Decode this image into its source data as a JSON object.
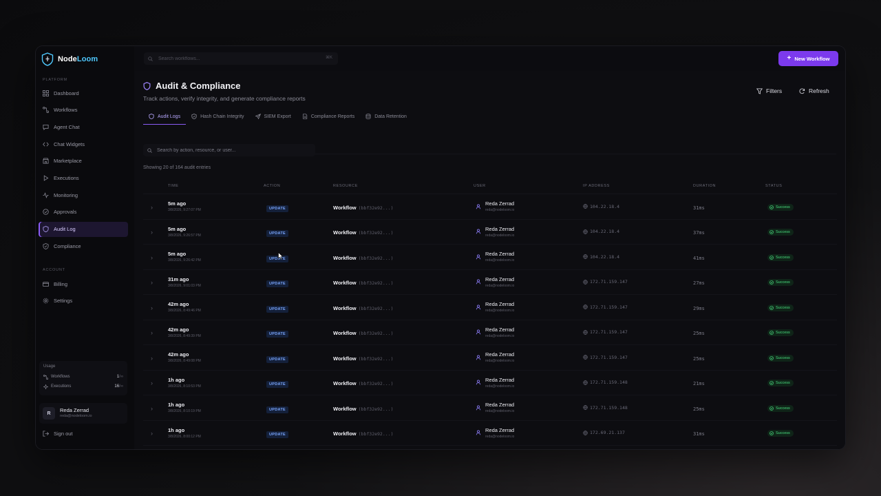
{
  "brand": {
    "name_a": "Node",
    "name_b": "Loom"
  },
  "search_top": {
    "placeholder": "Search workflows...",
    "shortcut": "⌘K"
  },
  "topbar": {
    "new_workflow": "New Workflow"
  },
  "sidebar": {
    "platform_label": "PLATFORM",
    "items": [
      {
        "label": "Dashboard",
        "icon": "grid-icon"
      },
      {
        "label": "Workflows",
        "icon": "workflow-icon"
      },
      {
        "label": "Agent Chat",
        "icon": "chat-icon"
      },
      {
        "label": "Chat Widgets",
        "icon": "code-icon"
      },
      {
        "label": "Marketplace",
        "icon": "store-icon"
      },
      {
        "label": "Executions",
        "icon": "play-icon"
      },
      {
        "label": "Monitoring",
        "icon": "activity-icon"
      },
      {
        "label": "Approvals",
        "icon": "check-circle-icon"
      },
      {
        "label": "Audit Log",
        "icon": "shield-icon"
      },
      {
        "label": "Compliance",
        "icon": "shield-check-icon"
      }
    ],
    "active_index": 8,
    "account_label": "ACCOUNT",
    "account_items": [
      {
        "label": "Billing",
        "icon": "credit-card-icon"
      },
      {
        "label": "Settings",
        "icon": "gear-icon"
      }
    ],
    "usage": {
      "title": "Usage",
      "workflows_label": "Workflows",
      "workflows_value": "1",
      "workflows_suffix": "/∞",
      "executions_label": "Executions",
      "executions_value": "16",
      "executions_suffix": "/∞"
    },
    "user": {
      "initial": "R",
      "name": "Reda Zerrad",
      "email": "reda@nodeloom.io"
    },
    "signout": "Sign out"
  },
  "page": {
    "title": "Audit & Compliance",
    "subtitle": "Track actions, verify integrity, and generate compliance reports",
    "filters": "Filters",
    "refresh": "Refresh",
    "tabs": [
      "Audit Logs",
      "Hash Chain Integrity",
      "SIEM Export",
      "Compliance Reports",
      "Data Retention"
    ],
    "search_placeholder": "Search by action, resource, or user...",
    "showing": "Showing 20 of 164 audit entries"
  },
  "table": {
    "columns": [
      "TIME",
      "ACTION",
      "RESOURCE",
      "USER",
      "IP ADDRESS",
      "DURATION",
      "STATUS"
    ],
    "rows": [
      {
        "time": "5m ago",
        "ts": "3/8/2026, 9:27:07 PM",
        "action": "UPDATE",
        "resource": "Workflow",
        "res_id": "(bbf32e92...)",
        "user": "Reda Zerrad",
        "email": "reda@nodeloom.io",
        "ip": "104.22.18.4",
        "duration": "31ms",
        "status": "Success"
      },
      {
        "time": "5m ago",
        "ts": "3/8/2026, 9:26:57 PM",
        "action": "UPDATE",
        "resource": "Workflow",
        "res_id": "(bbf32e92...)",
        "user": "Reda Zerrad",
        "email": "reda@nodeloom.io",
        "ip": "104.22.18.4",
        "duration": "37ms",
        "status": "Success"
      },
      {
        "time": "5m ago",
        "ts": "3/8/2026, 9:26:42 PM",
        "action": "UPDATE",
        "resource": "Workflow",
        "res_id": "(bbf32e92...)",
        "user": "Reda Zerrad",
        "email": "reda@nodeloom.io",
        "ip": "104.22.18.4",
        "duration": "41ms",
        "status": "Success"
      },
      {
        "time": "31m ago",
        "ts": "3/8/2026, 9:01:03 PM",
        "action": "UPDATE",
        "resource": "Workflow",
        "res_id": "(bbf32e92...)",
        "user": "Reda Zerrad",
        "email": "reda@nodeloom.io",
        "ip": "172.71.159.147",
        "duration": "27ms",
        "status": "Success"
      },
      {
        "time": "42m ago",
        "ts": "3/8/2026, 8:49:46 PM",
        "action": "UPDATE",
        "resource": "Workflow",
        "res_id": "(bbf32e92...)",
        "user": "Reda Zerrad",
        "email": "reda@nodeloom.io",
        "ip": "172.71.159.147",
        "duration": "29ms",
        "status": "Success"
      },
      {
        "time": "42m ago",
        "ts": "3/8/2026, 8:49:39 PM",
        "action": "UPDATE",
        "resource": "Workflow",
        "res_id": "(bbf32e92...)",
        "user": "Reda Zerrad",
        "email": "reda@nodeloom.io",
        "ip": "172.71.159.147",
        "duration": "25ms",
        "status": "Success"
      },
      {
        "time": "42m ago",
        "ts": "3/8/2026, 8:49:08 PM",
        "action": "UPDATE",
        "resource": "Workflow",
        "res_id": "(bbf32e92...)",
        "user": "Reda Zerrad",
        "email": "reda@nodeloom.io",
        "ip": "172.71.159.147",
        "duration": "25ms",
        "status": "Success"
      },
      {
        "time": "1h ago",
        "ts": "3/8/2026, 8:10:53 PM",
        "action": "UPDATE",
        "resource": "Workflow",
        "res_id": "(bbf32e92...)",
        "user": "Reda Zerrad",
        "email": "reda@nodeloom.io",
        "ip": "172.71.159.148",
        "duration": "21ms",
        "status": "Success"
      },
      {
        "time": "1h ago",
        "ts": "3/8/2026, 8:10:19 PM",
        "action": "UPDATE",
        "resource": "Workflow",
        "res_id": "(bbf32e92...)",
        "user": "Reda Zerrad",
        "email": "reda@nodeloom.io",
        "ip": "172.71.159.148",
        "duration": "25ms",
        "status": "Success"
      },
      {
        "time": "1h ago",
        "ts": "3/8/2026, 8:00:12 PM",
        "action": "UPDATE",
        "resource": "Workflow",
        "res_id": "(bbf32e92...)",
        "user": "Reda Zerrad",
        "email": "reda@nodeloom.io",
        "ip": "172.69.21.137",
        "duration": "31ms",
        "status": "Success"
      }
    ]
  },
  "colors": {
    "accent": "#7c3aed",
    "success": "#4ade80",
    "action": "#7aa7ff"
  }
}
